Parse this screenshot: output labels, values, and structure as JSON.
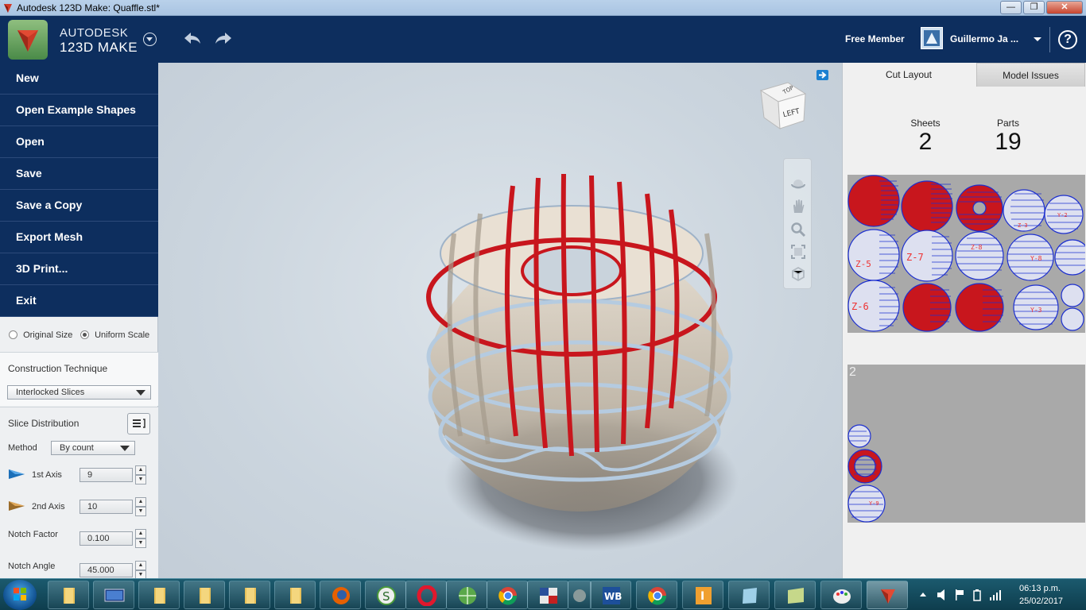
{
  "window": {
    "title": "Autodesk 123D Make: Quaffle.stl*"
  },
  "header": {
    "brand_line1": "AUTODESK",
    "brand_line2": "123D MAKE",
    "member_label": "Free Member",
    "username": "Guillermo Ja ...",
    "help_label": "?"
  },
  "menu": {
    "items": [
      {
        "label": "New"
      },
      {
        "label": "Open Example Shapes"
      },
      {
        "label": "Open"
      },
      {
        "label": "Save"
      },
      {
        "label": "Save a Copy"
      },
      {
        "label": "Export Mesh"
      },
      {
        "label": "3D Print..."
      },
      {
        "label": "Exit"
      }
    ]
  },
  "scale": {
    "original_label": "Original Size",
    "uniform_label": "Uniform Scale",
    "selected": "Uniform Scale"
  },
  "construction": {
    "title": "Construction Technique",
    "value": "Interlocked Slices"
  },
  "slice": {
    "title": "Slice Distribution",
    "method_label": "Method",
    "method_value": "By count",
    "axis1_label": "1st Axis",
    "axis1_value": "9",
    "axis2_label": "2nd Axis",
    "axis2_value": "10",
    "notch_factor_label": "Notch Factor",
    "notch_factor_value": "0.100",
    "notch_angle_label": "Notch Angle",
    "notch_angle_value": "45.000"
  },
  "viewcube": {
    "face_label": "LEFT",
    "top_label": "TOP"
  },
  "right_panel": {
    "tabs": [
      {
        "label": "Cut Layout"
      },
      {
        "label": "Model Issues"
      }
    ],
    "active_tab": "Cut Layout",
    "sheets_label": "Sheets",
    "sheets_value": "2",
    "parts_label": "Parts",
    "parts_value": "19",
    "sheet2_number": "2",
    "part_labels": [
      "Z-3",
      "Y-2",
      "Z-5",
      "Z-7",
      "Z-8",
      "Y-8",
      "Z-6",
      "Y-3",
      "Y-9"
    ]
  },
  "taskbar": {
    "time": "06:13 p.m.",
    "date": "25/02/2017"
  },
  "colors": {
    "accent": "#0d2e5e",
    "slice_red": "#c8161d",
    "slice_blue": "#1c2fcf"
  }
}
